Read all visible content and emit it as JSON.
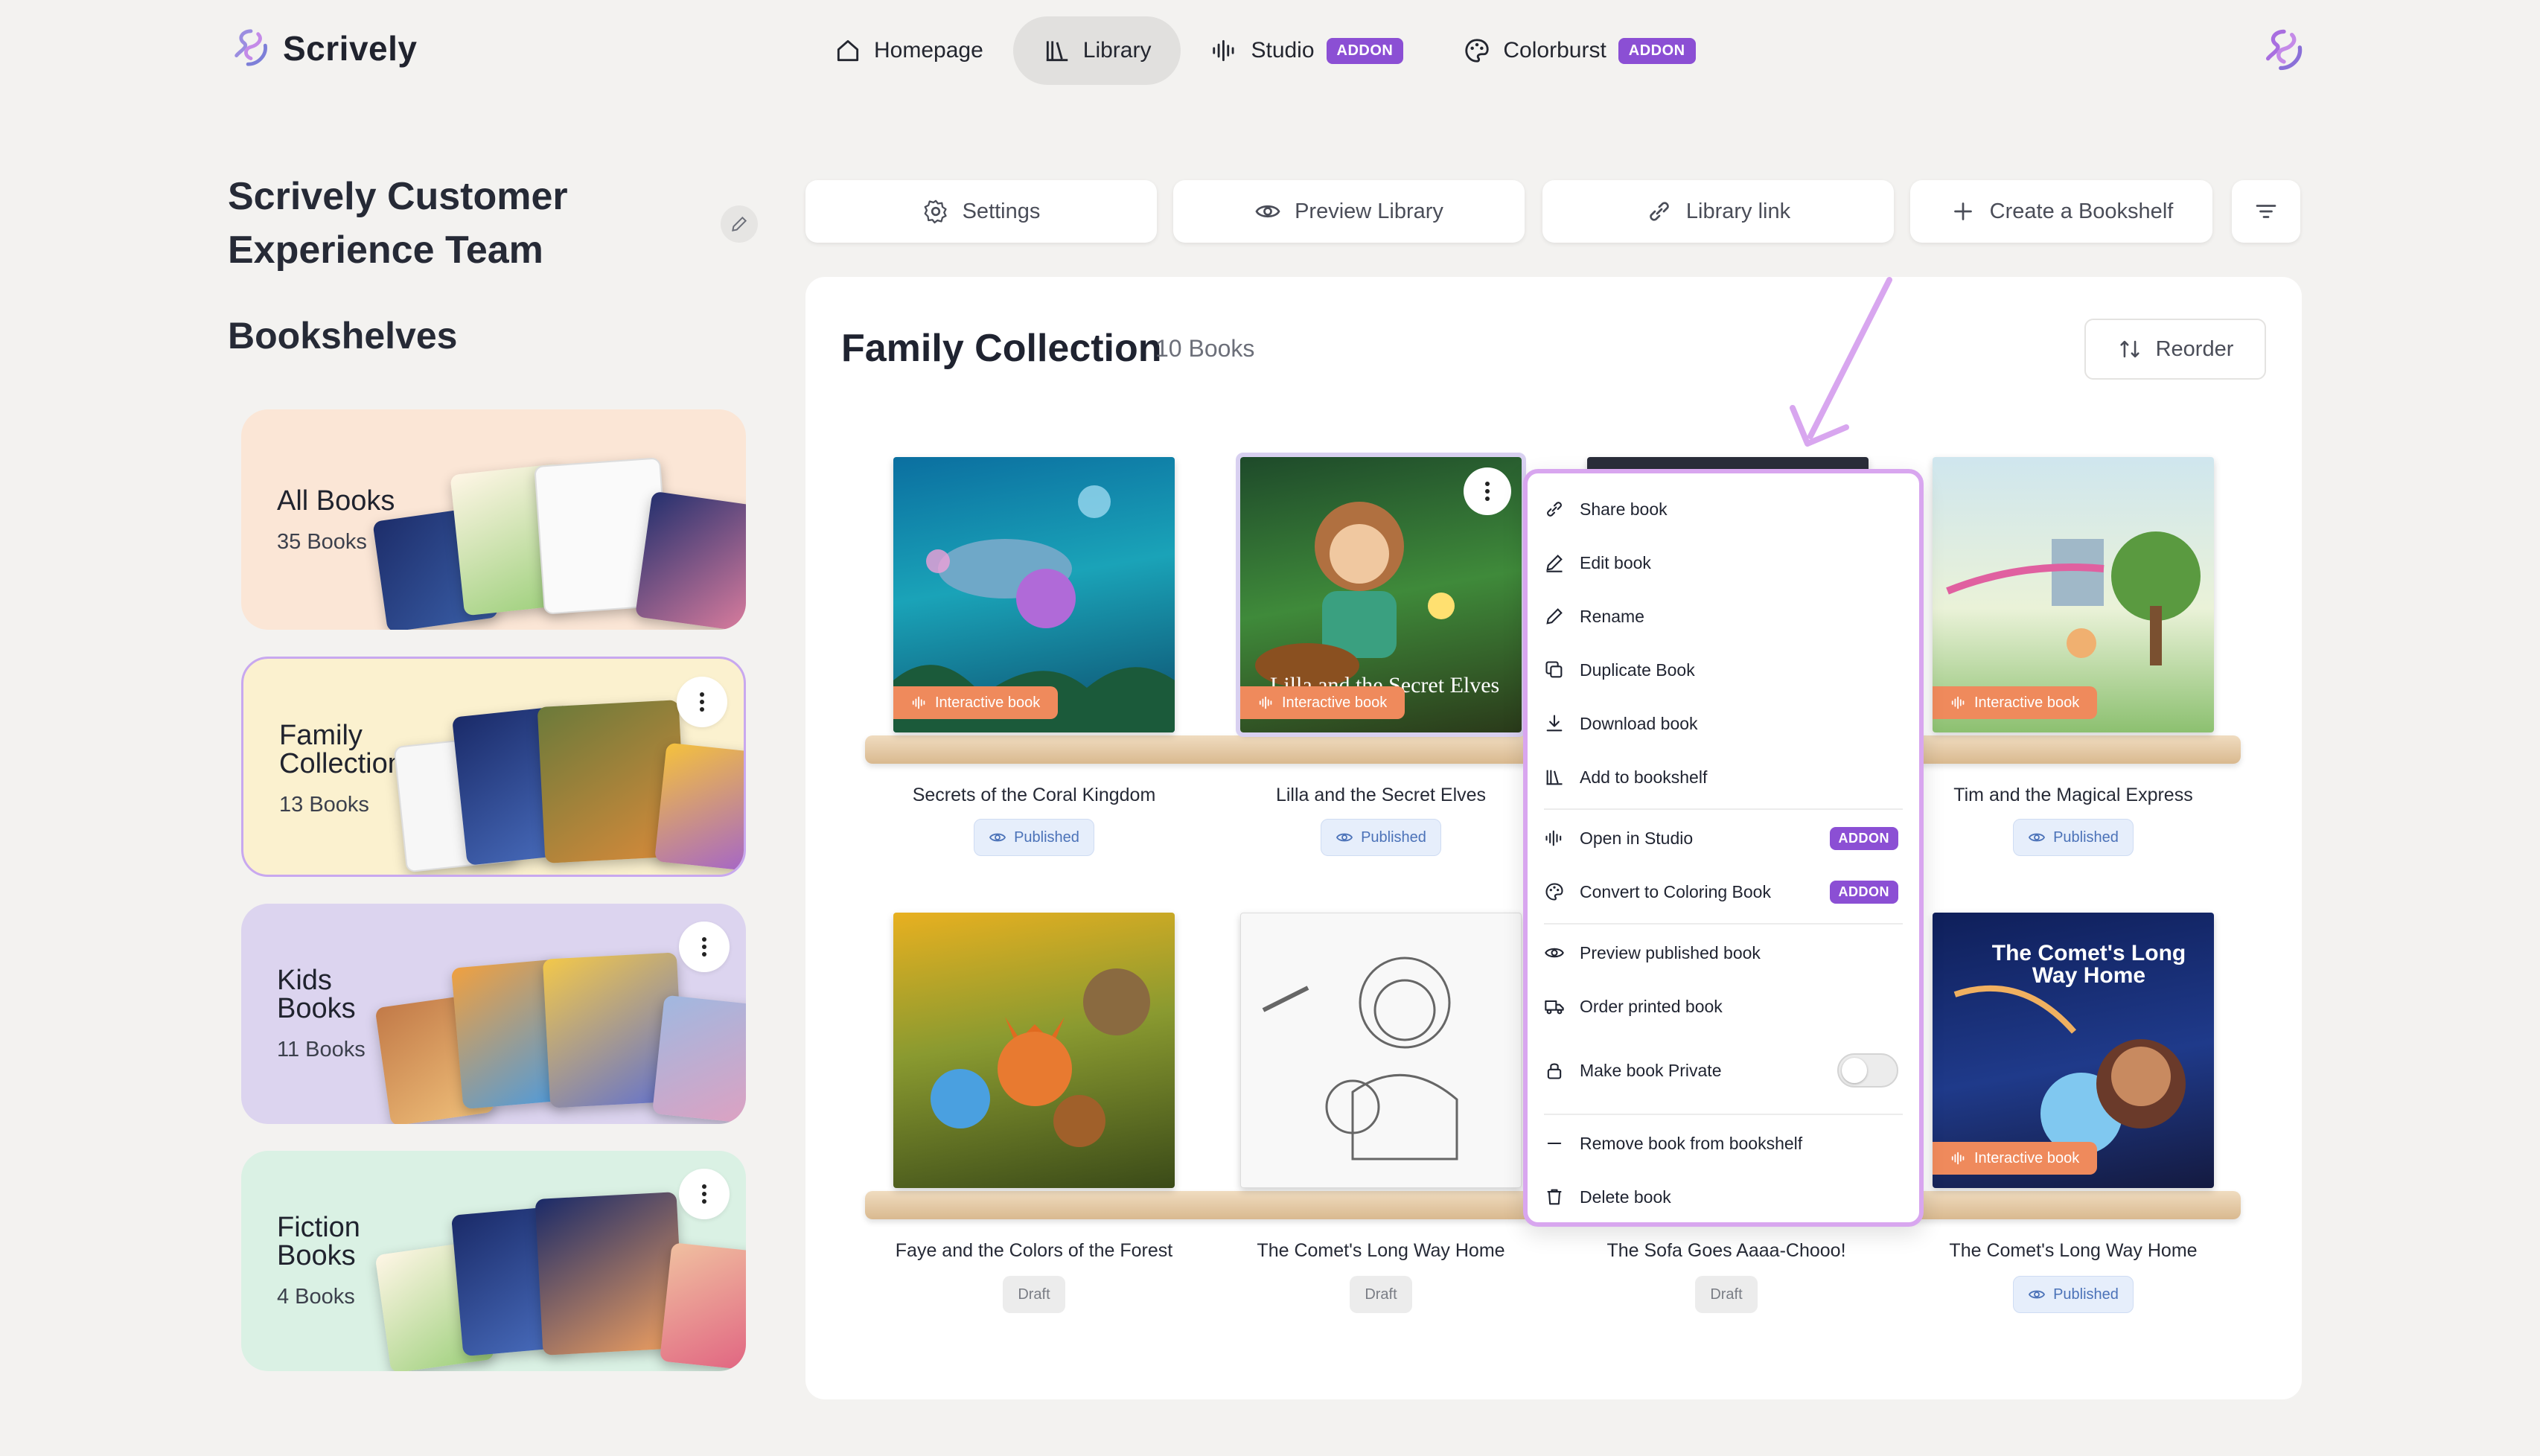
{
  "app": {
    "name": "Scrively"
  },
  "nav": {
    "items": [
      {
        "label": "Homepage",
        "icon": "home-icon",
        "active": false
      },
      {
        "label": "Library",
        "icon": "library-icon",
        "active": true
      },
      {
        "label": "Studio",
        "icon": "audio-wave-icon",
        "badge": "ADDON"
      },
      {
        "label": "Colorburst",
        "icon": "palette-icon",
        "badge": "ADDON"
      }
    ]
  },
  "team": {
    "title": "Scrively Customer Experience Team"
  },
  "sidebar": {
    "heading": "Bookshelves",
    "shelves": [
      {
        "title": "All Books",
        "count": "35 Books",
        "bg": "#fbe6d6"
      },
      {
        "title": "Family Collection",
        "count": "13 Books",
        "bg": "#fbf1cf"
      },
      {
        "title": "Kids Books",
        "count": "11 Books",
        "bg": "#dcd4ef"
      },
      {
        "title": "Fiction Books",
        "count": "4 Books",
        "bg": "#daf1e4"
      }
    ]
  },
  "toolbar": {
    "settings": "Settings",
    "preview": "Preview Library",
    "link": "Library link",
    "create": "Create a Bookshelf"
  },
  "collection": {
    "title": "Family Collection",
    "count": "10 Books",
    "reorder": "Reorder"
  },
  "books": [
    {
      "title": "Secrets of the Coral Kingdom",
      "status": "Published",
      "tag": "Interactive book"
    },
    {
      "title": "Lilla and the Secret Elves",
      "status": "Published",
      "tag": "Interactive book",
      "cover_text": "Lilla and the Secret Elves"
    },
    {
      "title": "Tim and the Magical Express",
      "status": "Published",
      "tag": "Interactive book"
    },
    {
      "title": "Faye and the Colors of the Forest",
      "status": "Draft"
    },
    {
      "title": "The Comet's Long Way Home",
      "status": "Draft"
    },
    {
      "title": "The Sofa Goes Aaaa-Chooo!",
      "status": "Draft"
    },
    {
      "title": "The Comet's Long Way Home",
      "status": "Published",
      "tag": "Interactive book",
      "cover_text": "The Comet's Long Way Home"
    }
  ],
  "menu": {
    "share": "Share book",
    "edit": "Edit book",
    "rename": "Rename",
    "duplicate": "Duplicate Book",
    "download": "Download book",
    "add": "Add to bookshelf",
    "studio": "Open in Studio",
    "coloring": "Convert to Coloring Book",
    "badge": "ADDON",
    "preview": "Preview published book",
    "order": "Order printed book",
    "private": "Make book Private",
    "private_on": false,
    "remove": "Remove book from bookshelf",
    "delete": "Delete book"
  },
  "colors": {
    "accent": "#8b4fd4",
    "tag": "#ef8a5c",
    "menu_border": "#d8a6ef"
  }
}
